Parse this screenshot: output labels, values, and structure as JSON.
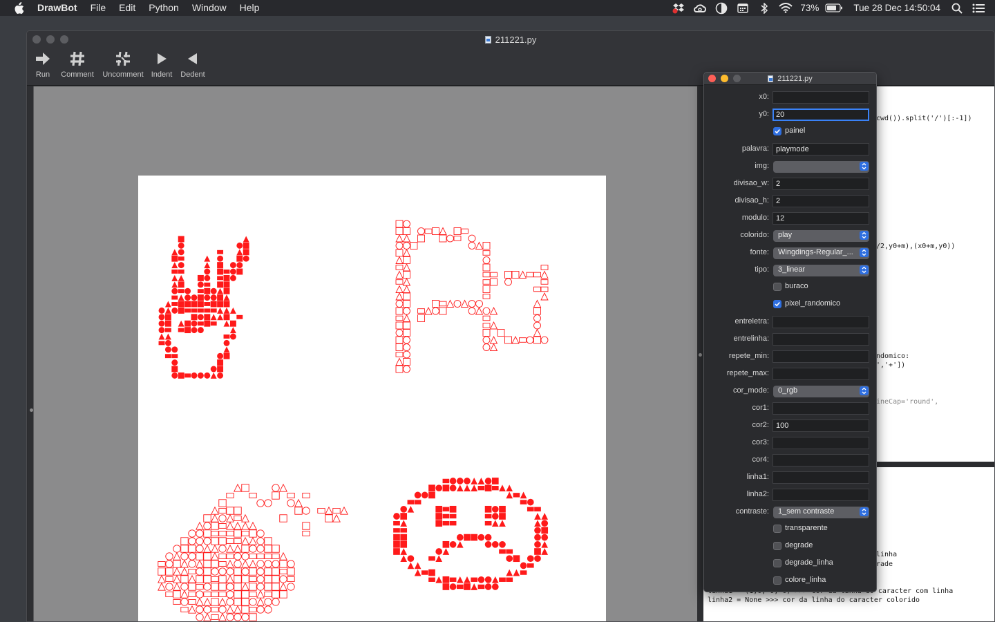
{
  "menubar": {
    "app_name": "DrawBot",
    "items": [
      "File",
      "Edit",
      "Python",
      "Window",
      "Help"
    ],
    "battery": "73%",
    "clock": "Tue 28 Dec  14:50:04"
  },
  "window": {
    "title": "211221.py"
  },
  "toolbar": {
    "run": "Run",
    "comment": "Comment",
    "uncomment": "Uncomment",
    "indent": "Indent",
    "dedent": "Dedent"
  },
  "canvas": {
    "artwork_color": "#ff1a1a",
    "glyphs": [
      "peace-hand",
      "flag",
      "bomb",
      "sad-face"
    ]
  },
  "code": {
    "lines": [
      {
        "visible": "cwd()).split('/')[:-1])"
      },
      {
        "visible": "/2,y0+m),(x0+m,y0))"
      },
      {
        "visible": "ndomico:"
      },
      {
        "visible": "','+'])"
      },
      {
        "visible": "ineCap='round',"
      }
    ]
  },
  "output": {
    "lines": [
      "linha",
      "rade",
      "linha1 = (1,0, 0, 0) >>> cor da linha do caracter com linha",
      "linha2 = None >>> cor da linha do caracter colorido"
    ]
  },
  "palette": {
    "title": "211221.py",
    "rows": [
      {
        "type": "text",
        "label": "x0:",
        "value": ""
      },
      {
        "type": "text",
        "label": "y0:",
        "value": "20",
        "focused": true
      },
      {
        "type": "check",
        "label": "painel",
        "checked": true
      },
      {
        "type": "text",
        "label": "palavra:",
        "value": "playmode"
      },
      {
        "type": "select",
        "label": "img:",
        "value": ""
      },
      {
        "type": "text",
        "label": "divisao_w:",
        "value": "2"
      },
      {
        "type": "text",
        "label": "divisao_h:",
        "value": "2"
      },
      {
        "type": "text",
        "label": "modulo:",
        "value": "12"
      },
      {
        "type": "select",
        "label": "colorido:",
        "value": "play"
      },
      {
        "type": "select",
        "label": "fonte:",
        "value": "Wingdings-Regular_..."
      },
      {
        "type": "select",
        "label": "tipo:",
        "value": "3_linear"
      },
      {
        "type": "check",
        "label": "buraco",
        "checked": false
      },
      {
        "type": "check",
        "label": "pixel_randomico",
        "checked": true
      },
      {
        "type": "text",
        "label": "entreletra:",
        "value": ""
      },
      {
        "type": "text",
        "label": "entrelinha:",
        "value": ""
      },
      {
        "type": "text",
        "label": "repete_min:",
        "value": ""
      },
      {
        "type": "text",
        "label": "repete_max:",
        "value": ""
      },
      {
        "type": "select",
        "label": "cor_mode:",
        "value": "0_rgb"
      },
      {
        "type": "text",
        "label": "cor1:",
        "value": ""
      },
      {
        "type": "text",
        "label": "cor2:",
        "value": "100"
      },
      {
        "type": "text",
        "label": "cor3:",
        "value": ""
      },
      {
        "type": "text",
        "label": "cor4:",
        "value": ""
      },
      {
        "type": "text",
        "label": "linha1:",
        "value": ""
      },
      {
        "type": "text",
        "label": "linha2:",
        "value": ""
      },
      {
        "type": "select",
        "label": "contraste:",
        "value": "1_sem contraste"
      },
      {
        "type": "check",
        "label": "transparente",
        "checked": false
      },
      {
        "type": "check",
        "label": "degrade",
        "checked": false
      },
      {
        "type": "check",
        "label": "degrade_linha",
        "checked": false
      },
      {
        "type": "check",
        "label": "colore_linha",
        "checked": false
      }
    ]
  }
}
